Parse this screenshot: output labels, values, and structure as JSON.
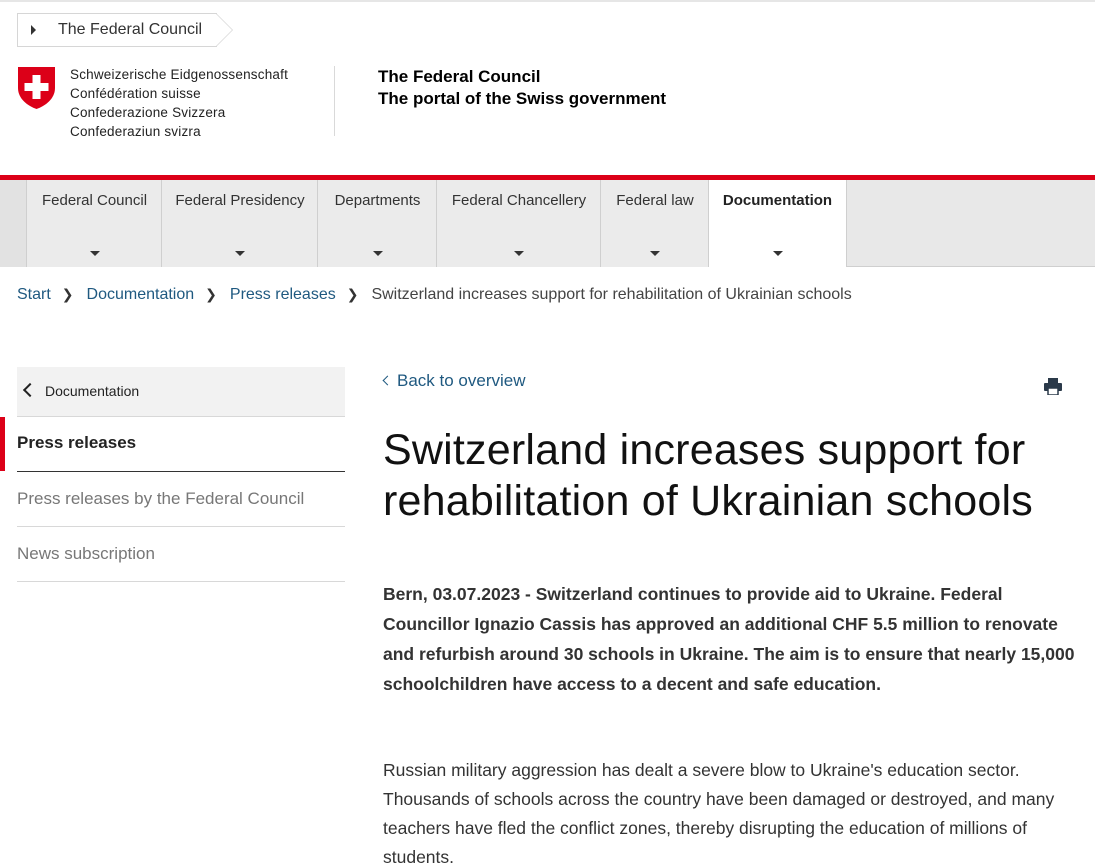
{
  "top_tab": {
    "label": "The Federal Council"
  },
  "logo": {
    "name": "swiss-cross-logo",
    "colors": {
      "red": "#dc0018",
      "white": "#ffffff"
    },
    "lines": [
      "Schweizerische Eidgenossenschaft",
      "Confédération suisse",
      "Confederazione Svizzera",
      "Confederaziun svizra"
    ]
  },
  "portal": {
    "title": "The Federal Council",
    "subtitle": "The portal of the Swiss government"
  },
  "nav": {
    "items": [
      {
        "label": "Federal Council"
      },
      {
        "label": "Federal Presidency"
      },
      {
        "label": "Departments"
      },
      {
        "label": "Federal Chancellery"
      },
      {
        "label": "Federal law"
      },
      {
        "label": "Documentation",
        "active": true
      }
    ],
    "accent": "#dc0018"
  },
  "breadcrumb": {
    "items": [
      "Start",
      "Documentation",
      "Press releases"
    ],
    "current": "Switzerland increases support for rehabilitation of Ukrainian schools"
  },
  "sidebar": {
    "back_label": "Documentation",
    "active_label": "Press releases",
    "links": [
      {
        "label": "Press releases by the Federal Council"
      },
      {
        "label": "News subscription"
      }
    ]
  },
  "content": {
    "back_link": "Back to overview",
    "print_icon": "printer-icon",
    "title": "Switzerland increases support for rehabilitation of Ukrainian schools",
    "lead": "Bern, 03.07.2023 - Switzerland continues to provide aid to Ukraine. Federal Councillor Ignazio Cassis has approved an additional CHF 5.5 million to renovate and refurbish around 30 schools in Ukraine. The aim is to ensure that nearly 15,000 schoolchildren have access to a decent and safe education.",
    "paragraph": "Russian military aggression has dealt a severe blow to Ukraine's education sector. Thousands of schools across the country have been damaged or destroyed, and many teachers have fled the conflict zones, thereby disrupting the education of millions of students."
  }
}
